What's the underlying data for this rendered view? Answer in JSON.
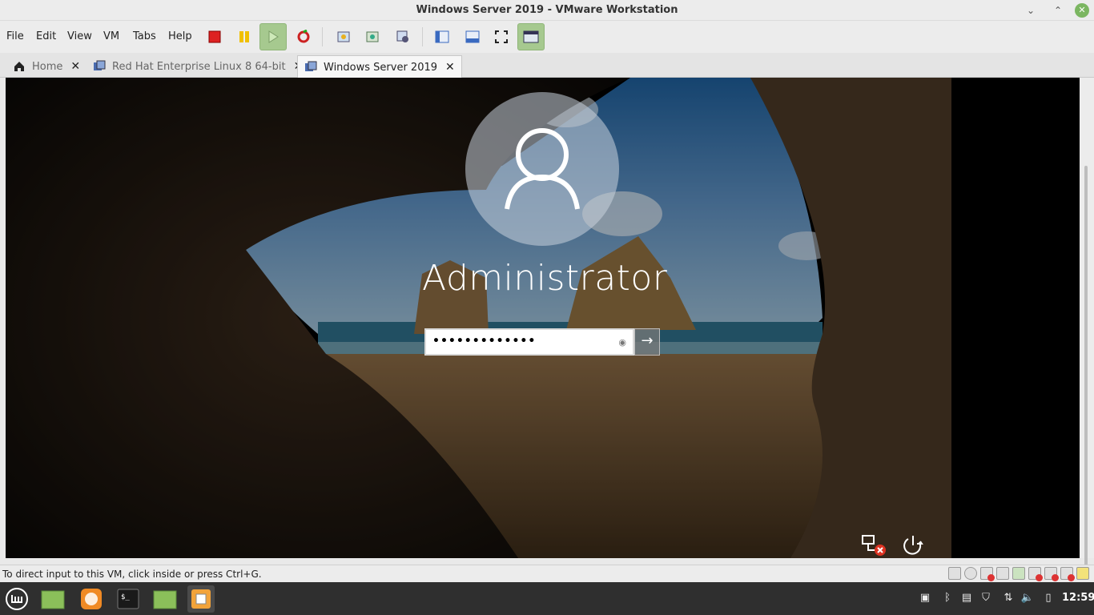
{
  "window": {
    "title": "Windows Server 2019 - VMware Workstation"
  },
  "menu": [
    {
      "label": "File"
    },
    {
      "label": "Edit"
    },
    {
      "label": "View"
    },
    {
      "label": "VM"
    },
    {
      "label": "Tabs"
    },
    {
      "label": "Help"
    }
  ],
  "toolbar_icons": [
    "power-off-icon",
    "suspend-icon",
    "play-icon",
    "restart-icon",
    "snapshot-icon",
    "revert-snapshot-icon",
    "snapshot-manager-icon",
    "sidebar-icon",
    "thumbnail-bar-icon",
    "fullscreen-icon",
    "unity-icon"
  ],
  "tabs": [
    {
      "label": "Home",
      "icon": "home-icon",
      "active": false
    },
    {
      "label": "Red Hat Enterprise Linux 8 64-bit",
      "icon": "vm-icon",
      "active": false
    },
    {
      "label": "Windows Server 2019",
      "icon": "vm-icon",
      "active": true
    }
  ],
  "login": {
    "username": "Administrator",
    "password_masked": "•••••••••••••",
    "submit_icon": "arrow-right-icon"
  },
  "status": {
    "message": "To direct input to this VM, click inside or press Ctrl+G."
  },
  "taskbar": {
    "clock": "12:59"
  },
  "colors": {
    "accent_green": "#a6c98f",
    "taskbar": "#2f2f2f",
    "mint": "#7bb661"
  }
}
